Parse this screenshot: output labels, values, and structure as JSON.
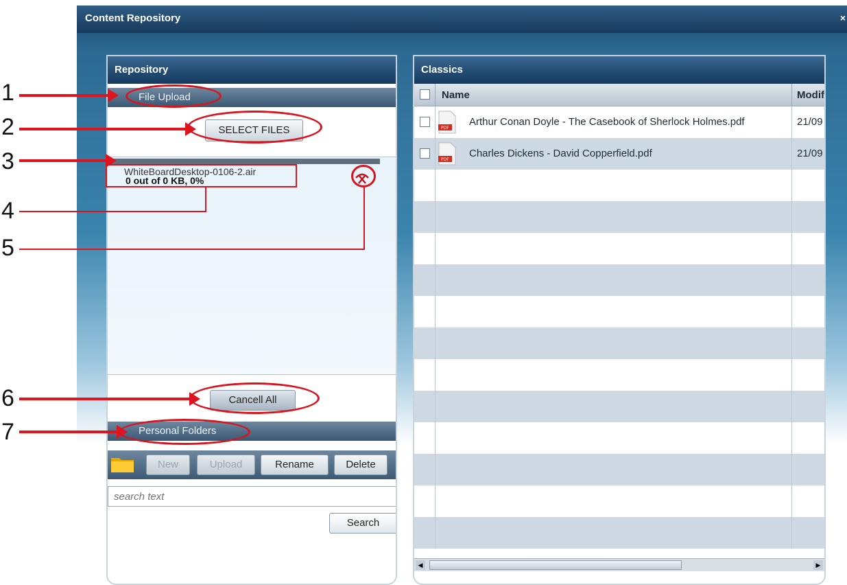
{
  "window": {
    "title": "Content Repository",
    "close": "×"
  },
  "repository": {
    "title": "Repository",
    "file_upload": {
      "section_label": "File Upload",
      "select_files_label": "SELECT FILES",
      "upload_item": {
        "file_name": "WhiteBoardDesktop-0106-2.air",
        "progress_text": "0 out of 0 KB, 0%",
        "progress_fraction": 0
      },
      "cancel_all_label": "Cancell All"
    },
    "personal_folders": {
      "section_label": "Personal Folders",
      "buttons": {
        "new": "New",
        "upload": "Upload",
        "rename": "Rename",
        "delete": "Delete"
      },
      "search_placeholder": "search text",
      "search_button": "Search"
    }
  },
  "classics": {
    "title": "Classics",
    "columns": {
      "name": "Name",
      "modified": "Modifi"
    },
    "rows": [
      {
        "name": "Arthur Conan Doyle - The Casebook of Sherlock Holmes.pdf",
        "modified": "21/09",
        "icon": "pdf-icon"
      },
      {
        "name": "Charles Dickens - David Copperfield.pdf",
        "modified": "21/09",
        "icon": "pdf-icon"
      }
    ]
  },
  "annotations": [
    "1",
    "2",
    "3",
    "4",
    "5",
    "6",
    "7"
  ],
  "colors": {
    "accent_red": "#e0141e",
    "header_blue": "#14395d"
  }
}
